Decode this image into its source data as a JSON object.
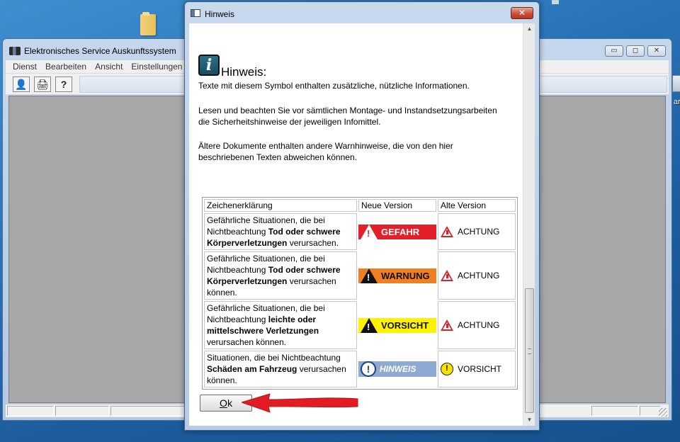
{
  "desktop": {
    "right_icon_label": "ar"
  },
  "main_window": {
    "title": "Elektronisches Service Auskunftssystem",
    "controls": {
      "minimize": "▭",
      "maximize": "◻",
      "close": "✕"
    },
    "menu": [
      "Dienst",
      "Bearbeiten",
      "Ansicht",
      "Einstellungen"
    ],
    "toolbar": [
      "👤",
      "🖨",
      "?"
    ]
  },
  "dialog": {
    "title": "Hinweis",
    "close_label": "✕",
    "heading": "Hinweis:",
    "intro": "Texte mit diesem Symbol enthalten zusätzliche, nützliche Informationen.",
    "paragraph_1": "Lesen und beachten Sie vor sämtlichen Montage- und Instandsetzungsarbeiten die Sicherheitshinweise der jeweiligen Infomittel.",
    "paragraph_2": "Ältere Dokumente enthalten andere Warnhinweise, die von den hier beschriebenen Texten abweichen können.",
    "table": {
      "headers": [
        "Zeichenerklärung",
        "Neue Version",
        "Alte Version"
      ],
      "rows": [
        {
          "desc_pre": "Gefährliche Situationen, die bei Nichtbeachtung ",
          "desc_bold": "Tod oder schwere Körperverletzungen",
          "desc_post": " verursachen.",
          "new_label": "GEFAHR",
          "new_color": "#e3202a",
          "old_label": "ACHTUNG"
        },
        {
          "desc_pre": "Gefährliche Situationen, die bei Nichtbeachtung ",
          "desc_bold": "Tod oder schwere Körperverletzungen",
          "desc_post": " verursachen können.",
          "new_label": "WARNUNG",
          "new_color": "#f07f22",
          "old_label": "ACHTUNG"
        },
        {
          "desc_pre": "Gefährliche Situationen, die bei Nichtbeachtung ",
          "desc_bold": "leichte oder mittelschwere Verletzungen",
          "desc_post": " verursachen können.",
          "new_label": "VORSICHT",
          "new_color": "#fff200",
          "old_label": "ACHTUNG"
        },
        {
          "desc_pre": "Situationen, die bei Nichtbeachtung ",
          "desc_bold": "Schäden am Fahrzeug",
          "desc_post": " verursachen können.",
          "new_label": "HINWEIS",
          "new_color": "#8ea9d2",
          "old_label": "VORSICHT"
        }
      ]
    },
    "ok_accel": "O",
    "ok_rest": "k",
    "arrow_color": "#e31b23"
  }
}
